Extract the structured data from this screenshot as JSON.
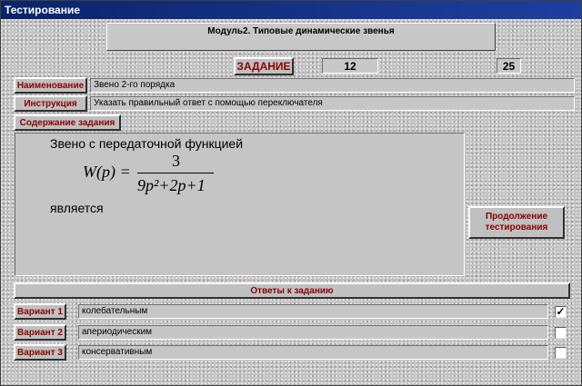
{
  "window": {
    "title": "Тестирование"
  },
  "module": {
    "title": "Модуль2. Типовые динамические звенья"
  },
  "task": {
    "label": "ЗАДАНИЕ",
    "current": "12",
    "total": "25"
  },
  "name": {
    "label": "Наименование",
    "value": "Звено 2-го порядка"
  },
  "instruction": {
    "label": "Инструкция",
    "value": "Указать правильный ответ с помощью переключателя"
  },
  "content": {
    "label": "Содержание задания",
    "line1": "Звено с передаточной функцией",
    "formula_lhs": "W(p) =",
    "numerator": "3",
    "denominator": "9p²+2p+1",
    "line2": "является"
  },
  "continue_button": {
    "label": "Продолжение тестирования"
  },
  "answers": {
    "header": "Ответы к заданию",
    "options": [
      {
        "label": "Вариант 1",
        "text": "колебательным",
        "checked": "✓"
      },
      {
        "label": "Вариант 2",
        "text": "апериодическим",
        "checked": ""
      },
      {
        "label": "Вариант 3",
        "text": "консервативным",
        "checked": ""
      }
    ]
  }
}
